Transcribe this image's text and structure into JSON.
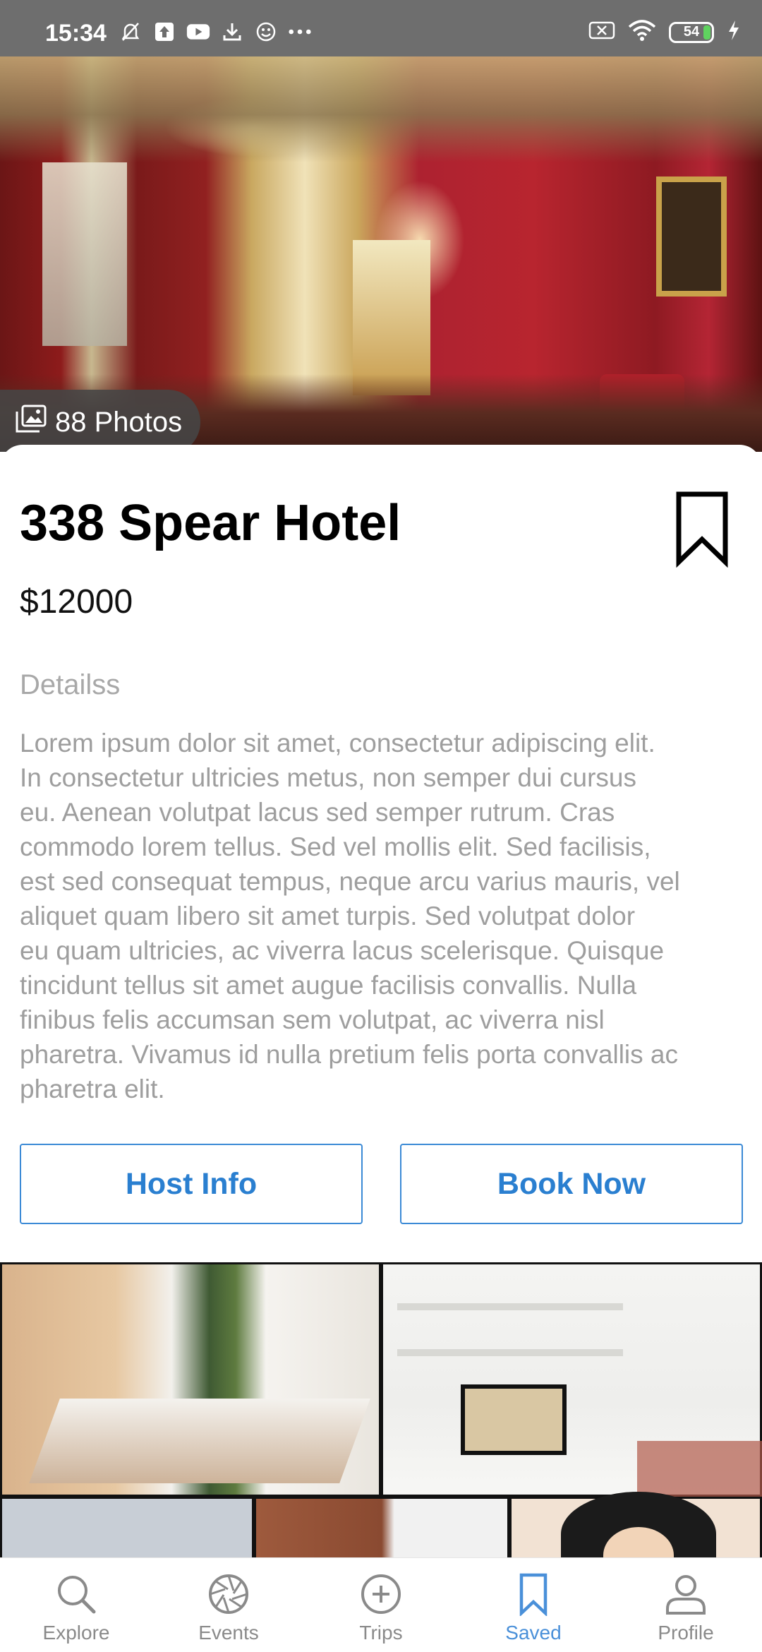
{
  "status_bar": {
    "time": "15:34",
    "battery": "54",
    "left_icons": [
      "silent-bell-icon",
      "upload-icon",
      "youtube-icon",
      "download-icon",
      "smiley-icon",
      "more-dots-icon"
    ],
    "right_icons": [
      "sim-x-icon",
      "wifi-icon",
      "battery-icon",
      "charging-bolt-icon"
    ]
  },
  "hero": {
    "photos_label": "88 Photos"
  },
  "listing": {
    "title": "338 Spear Hotel",
    "price": "$12000",
    "details_label": "Detailss",
    "description_lines": [
      "Lorem ipsum dolor sit amet, consectetur adipiscing elit.",
      "In consectetur ultricies metus, non semper dui cursus",
      "eu. Aenean volutpat lacus sed semper rutrum. Cras",
      "commodo lorem tellus. Sed vel mollis elit. Sed facilisis,",
      "est sed consequat tempus, neque arcu varius mauris, vel",
      "aliquet quam libero sit amet turpis. Sed volutpat dolor",
      "eu quam ultricies, ac viverra lacus scelerisque. Quisque",
      "tincidunt tellus sit amet augue facilisis convallis. Nulla",
      "finibus felis accumsan sem volutpat, ac viverra nisl",
      "pharetra. Vivamus id nulla pretium felis porta convallis ac",
      "pharetra elit."
    ]
  },
  "actions": {
    "host_info": "Host Info",
    "book_now": "Book Now"
  },
  "bottom_nav": {
    "active": "Saved",
    "items": [
      {
        "label": "Explore",
        "icon": "search-icon"
      },
      {
        "label": "Events",
        "icon": "aperture-icon"
      },
      {
        "label": "Trips",
        "icon": "plus-circle-icon"
      },
      {
        "label": "Saved",
        "icon": "bookmark-icon"
      },
      {
        "label": "Profile",
        "icon": "person-icon"
      }
    ]
  },
  "colors": {
    "accent": "#2a7fd0",
    "nav_active": "#4a90d9",
    "muted_text": "#9e9e9e",
    "status_bar": "#6e6e6e"
  }
}
